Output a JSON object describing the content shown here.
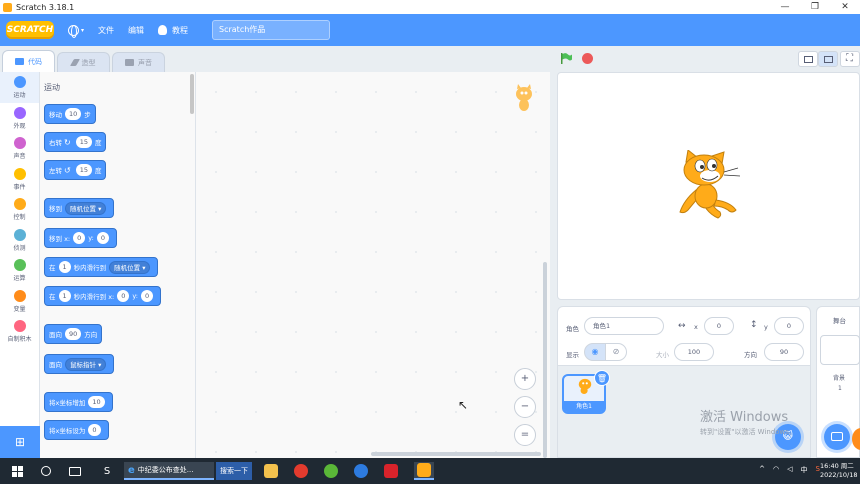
{
  "window": {
    "title": "Scratch 3.18.1",
    "controls": [
      "—",
      "❐",
      "✕"
    ]
  },
  "menubar": {
    "logo_text": "SCRATCH",
    "language_caret": "▾",
    "file": "文件",
    "edit": "编辑",
    "tutorials": "教程",
    "project_title": "Scratch作品"
  },
  "tabs": {
    "code": "代码",
    "costumes": "造型",
    "sounds": "声音"
  },
  "categories": [
    {
      "label": "运动",
      "color": "#4c97ff"
    },
    {
      "label": "外观",
      "color": "#9966ff"
    },
    {
      "label": "声音",
      "color": "#cf63cf"
    },
    {
      "label": "事件",
      "color": "#ffbf00"
    },
    {
      "label": "控制",
      "color": "#ffab19"
    },
    {
      "label": "侦测",
      "color": "#5cb1d6"
    },
    {
      "label": "运算",
      "color": "#59c059"
    },
    {
      "label": "变量",
      "color": "#ff8c1a"
    },
    {
      "label": "自制积木",
      "color": "#ff6680"
    }
  ],
  "palette": {
    "section_title": "运动",
    "move": {
      "label": "移动",
      "value": "10",
      "unit": "步"
    },
    "turn_right": {
      "label": "右转",
      "icon": "↻",
      "value": "15",
      "unit": "度"
    },
    "turn_left": {
      "label": "左转",
      "icon": "↺",
      "value": "15",
      "unit": "度"
    },
    "goto": {
      "label": "移到",
      "dropdown": "随机位置 ▾"
    },
    "goto_xy": {
      "label": "移到 x:",
      "x": "0",
      "ylabel": "y:",
      "y": "0"
    },
    "glide": {
      "label": "在",
      "secs": "1",
      "mid": "秒内滑行到",
      "dropdown": "随机位置 ▾"
    },
    "glide_xy": {
      "label": "在",
      "secs": "1",
      "mid": "秒内滑行到 x:",
      "x": "0",
      "ylabel": "y:",
      "y": "0"
    },
    "point_dir": {
      "label": "面向",
      "value": "90",
      "unit": "方向"
    },
    "point_towards": {
      "label": "面向",
      "dropdown": "鼠标指针 ▾"
    },
    "change_x": {
      "label": "将x坐标增加",
      "value": "10"
    },
    "set_x": {
      "label": "将x坐标设为",
      "value": "0"
    }
  },
  "zoom": {
    "in": "+",
    "out": "−",
    "reset": "="
  },
  "sprite_info": {
    "sprite_label": "角色",
    "sprite_name": "角色1",
    "x_arrow": "↔",
    "x_label": "x",
    "x_value": "0",
    "y_arrow": "↕",
    "y_label": "y",
    "y_value": "0",
    "show_label": "显示",
    "size_label": "大小",
    "size_value": "100",
    "direction_label": "方向",
    "direction_value": "90"
  },
  "sprite_list": {
    "thumb_label": "角色1",
    "delete_icon": "🗑"
  },
  "stage_pane": {
    "title": "舞台",
    "backdrop_label": "背景",
    "backdrop_count": "1"
  },
  "watermark": {
    "line1": "激活 Windows",
    "line2": "转到\"设置\"以激活 Windows。"
  },
  "taskbar": {
    "ie_task": "中纪委公布查处...",
    "search_btn": "搜索一下",
    "tray": [
      "^",
      "中"
    ],
    "time": "16:40 周二",
    "date": "2022/10/18"
  },
  "colors": {
    "accent": "#4c97ff",
    "menubar": "#4c97ff"
  }
}
